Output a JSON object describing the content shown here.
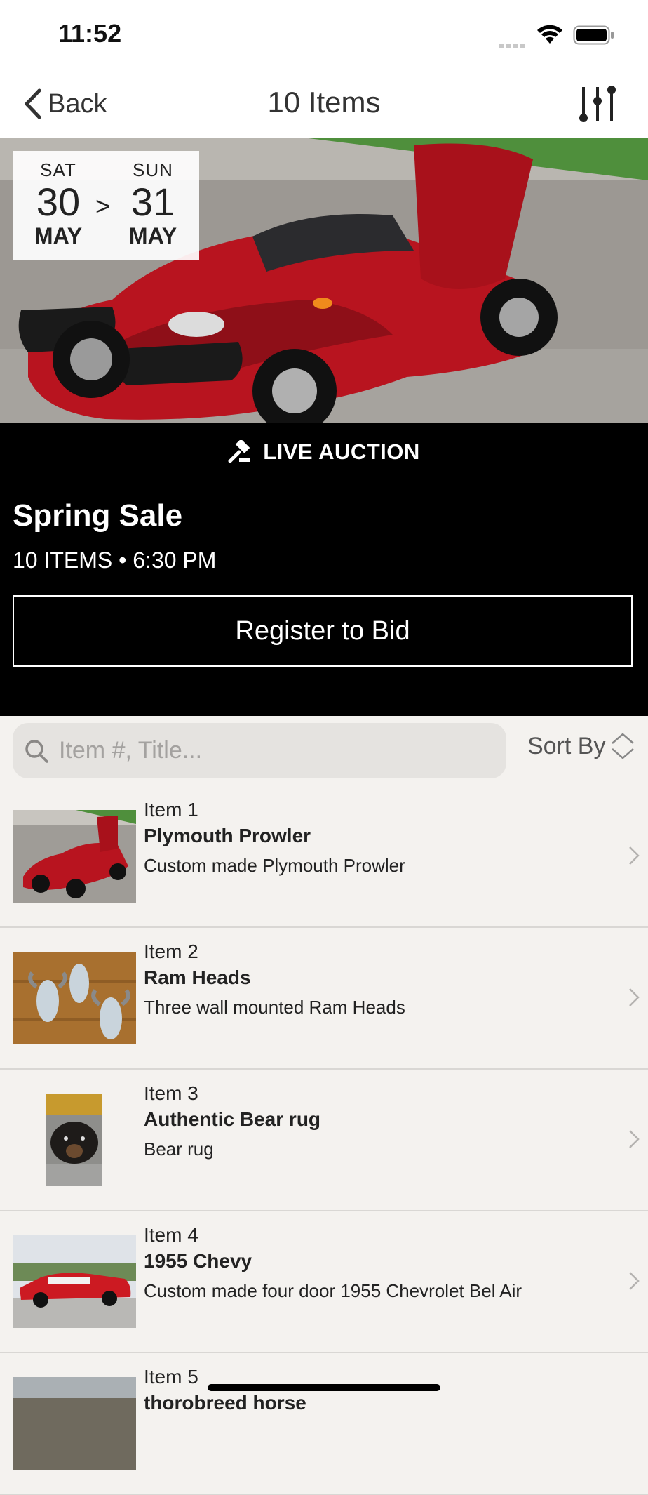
{
  "status_bar": {
    "time": "11:52"
  },
  "nav": {
    "back_label": "Back",
    "title": "10 Items"
  },
  "hero": {
    "start": {
      "dow": "SAT",
      "day": "30",
      "month": "MAY"
    },
    "separator": ">",
    "end": {
      "dow": "SUN",
      "day": "31",
      "month": "MAY"
    }
  },
  "banner": {
    "label": "LIVE AUCTION"
  },
  "sale": {
    "title": "Spring Sale",
    "meta": "10 ITEMS • 6:30 PM",
    "register_label": "Register to Bid"
  },
  "search": {
    "placeholder": "Item #, Title..."
  },
  "sort": {
    "label": "Sort By"
  },
  "items": [
    {
      "number": "Item 1",
      "title": "Plymouth Prowler",
      "description": "Custom made Plymouth Prowler",
      "thumb": "red-roadster-photo"
    },
    {
      "number": "Item 2",
      "title": "Ram Heads",
      "description": "Three wall mounted Ram Heads",
      "thumb": "ram-heads-photo"
    },
    {
      "number": "Item 3",
      "title": "Authentic Bear rug",
      "description": "Bear rug",
      "thumb": "bear-rug-photo"
    },
    {
      "number": "Item 4",
      "title": "1955 Chevy",
      "description": "Custom made four door 1955 Chevrolet Bel Air",
      "thumb": "red-chevy-photo"
    },
    {
      "number": "Item 5",
      "title": "thorobreed horse",
      "description": "",
      "thumb": "horse-photo"
    }
  ],
  "colors": {
    "header_bg": "#000000",
    "list_bg": "#f4f2ef",
    "car_red": "#b8141f"
  }
}
